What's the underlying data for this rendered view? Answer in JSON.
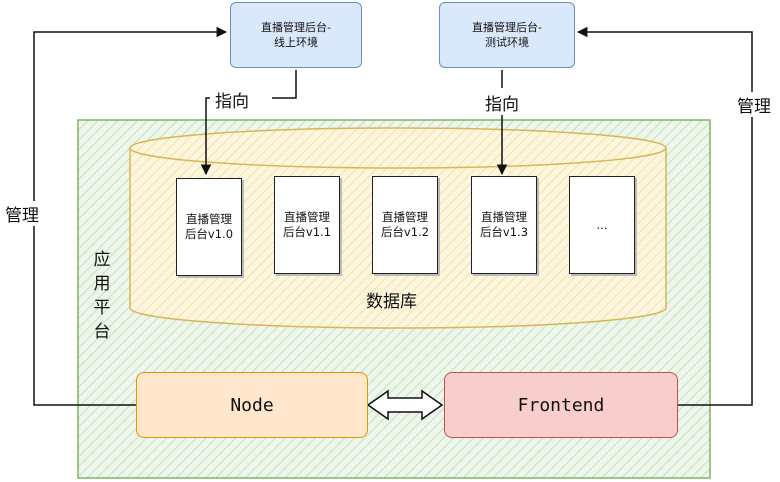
{
  "envs": {
    "online": {
      "line1": "直播管理后台-",
      "line2": "线上环境"
    },
    "test": {
      "line1": "直播管理后台-",
      "line2": "测试环境"
    }
  },
  "labels": {
    "point_left": "指向",
    "point_right": "指向",
    "manage_left": "管理",
    "manage_right": "管理",
    "database": "数据库",
    "platform": [
      "应",
      "用",
      "平",
      "台"
    ]
  },
  "versions": [
    {
      "line1": "直播管理",
      "line2": "后台v1.0"
    },
    {
      "line1": "直播管理",
      "line2": "后台v1.1"
    },
    {
      "line1": "直播管理",
      "line2": "后台v1.2"
    },
    {
      "line1": "直播管理",
      "line2": "后台v1.3"
    },
    {
      "line1": "...",
      "line2": ""
    }
  ],
  "services": {
    "node": "Node",
    "frontend": "Frontend"
  },
  "colors": {
    "platform_fill": "#d5e8d4",
    "platform_border": "#82b366",
    "db_fill": "#fff2cc",
    "db_border": "#d6b656",
    "env_fill": "#dae8fc",
    "env_border": "#6c8ebf",
    "node_fill": "#ffe6cc",
    "node_border": "#d79b00",
    "frontend_fill": "#f8cecc",
    "frontend_border": "#b85450"
  }
}
